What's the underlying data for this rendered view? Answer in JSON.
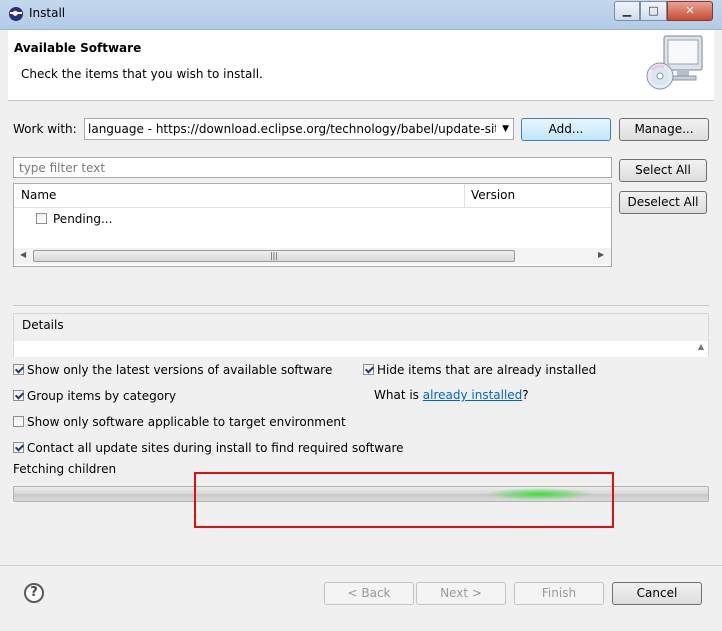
{
  "window": {
    "title": "Install"
  },
  "header": {
    "title": "Available Software",
    "description": "Check the items that you wish to install."
  },
  "work_with": {
    "label": "Work with:",
    "value": "language - https://download.eclipse.org/technology/babel/update-site"
  },
  "buttons": {
    "add": "Add...",
    "manage": "Manage...",
    "select_all": "Select All",
    "deselect_all": "Deselect All",
    "back": "< Back",
    "next": "Next >",
    "finish": "Finish",
    "cancel": "Cancel"
  },
  "filter": {
    "placeholder": "type filter text"
  },
  "tree": {
    "columns": [
      "Name",
      "Version"
    ],
    "items": [
      {
        "label": "Pending...",
        "checked": false
      }
    ]
  },
  "details": {
    "title": "Details"
  },
  "options": {
    "show_latest": {
      "label": "Show only the latest versions of available software",
      "checked": true
    },
    "hide_installed": {
      "label": "Hide items that are already installed",
      "checked": true
    },
    "group_by_category": {
      "label": "Group items by category",
      "checked": true
    },
    "what_is_prefix": "What is ",
    "what_is_link": "already installed",
    "what_is_suffix": "?",
    "show_applicable": {
      "label": "Show only software applicable to target environment",
      "checked": false
    },
    "contact_sites": {
      "label": "Contact all update sites during install to find required software",
      "checked": true
    }
  },
  "status": {
    "text": "Fetching children"
  },
  "colors": {
    "annotation_border": "#e01010",
    "progress_glow": "#3ddc3d",
    "link": "#0066cc"
  }
}
